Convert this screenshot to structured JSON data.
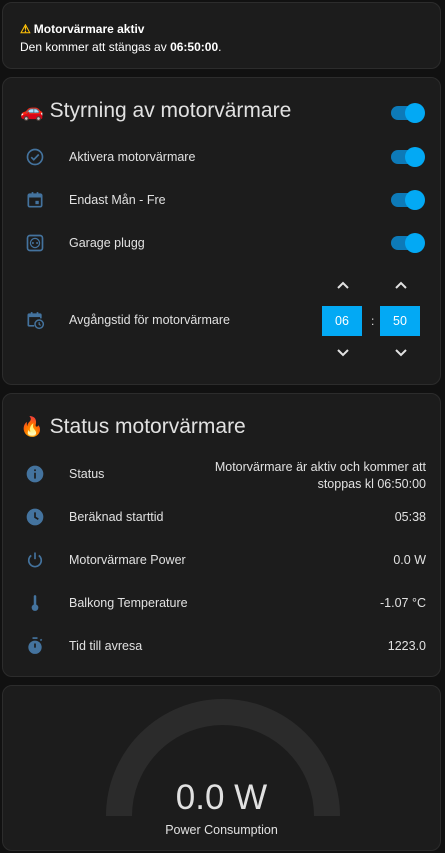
{
  "alert": {
    "title": "Motorvärmare aktiv",
    "body_prefix": "Den kommer att stängas av ",
    "body_time": "06:50:00",
    "body_suffix": ".",
    "icon": "warning-icon"
  },
  "control": {
    "title": "Styrning av motorvärmare",
    "emoji": "🚗",
    "master_toggle": true,
    "items": [
      {
        "label": "Aktivera motorvärmare",
        "icon": "check-circle-icon",
        "on": true
      },
      {
        "label": "Endast Mån - Fre",
        "icon": "calendar-icon",
        "on": true
      },
      {
        "label": "Garage plugg",
        "icon": "power-socket-icon",
        "on": true
      }
    ],
    "departure": {
      "label": "Avgångstid för motorvärmare",
      "icon": "calendar-clock-icon",
      "hour": "06",
      "minute": "50",
      "separator": ":"
    }
  },
  "status": {
    "title": "Status motorvärmare",
    "emoji": "🔥",
    "rows": [
      {
        "label": "Status",
        "icon": "info-icon",
        "value_line1": "Motorvärmare är aktiv och kommer att",
        "value_line2": "stoppas kl 06:50:00"
      },
      {
        "label": "Beräknad starttid",
        "icon": "clock-icon",
        "value": "05:38"
      },
      {
        "label": "Motorvärmare Power",
        "icon": "power-icon",
        "value": "0.0 W"
      },
      {
        "label": "Balkong Temperature",
        "icon": "thermometer-icon",
        "value": "-1.07 °C"
      },
      {
        "label": "Tid till avresa",
        "icon": "timer-icon",
        "value": "1223.0"
      }
    ]
  },
  "gauge": {
    "value": "0.0 W",
    "name": "Power Consumption",
    "fraction": 0.0
  },
  "colors": {
    "accent": "#03a9f4",
    "icon": "#44739e",
    "card": "#1c1c1c",
    "background": "#111111"
  }
}
